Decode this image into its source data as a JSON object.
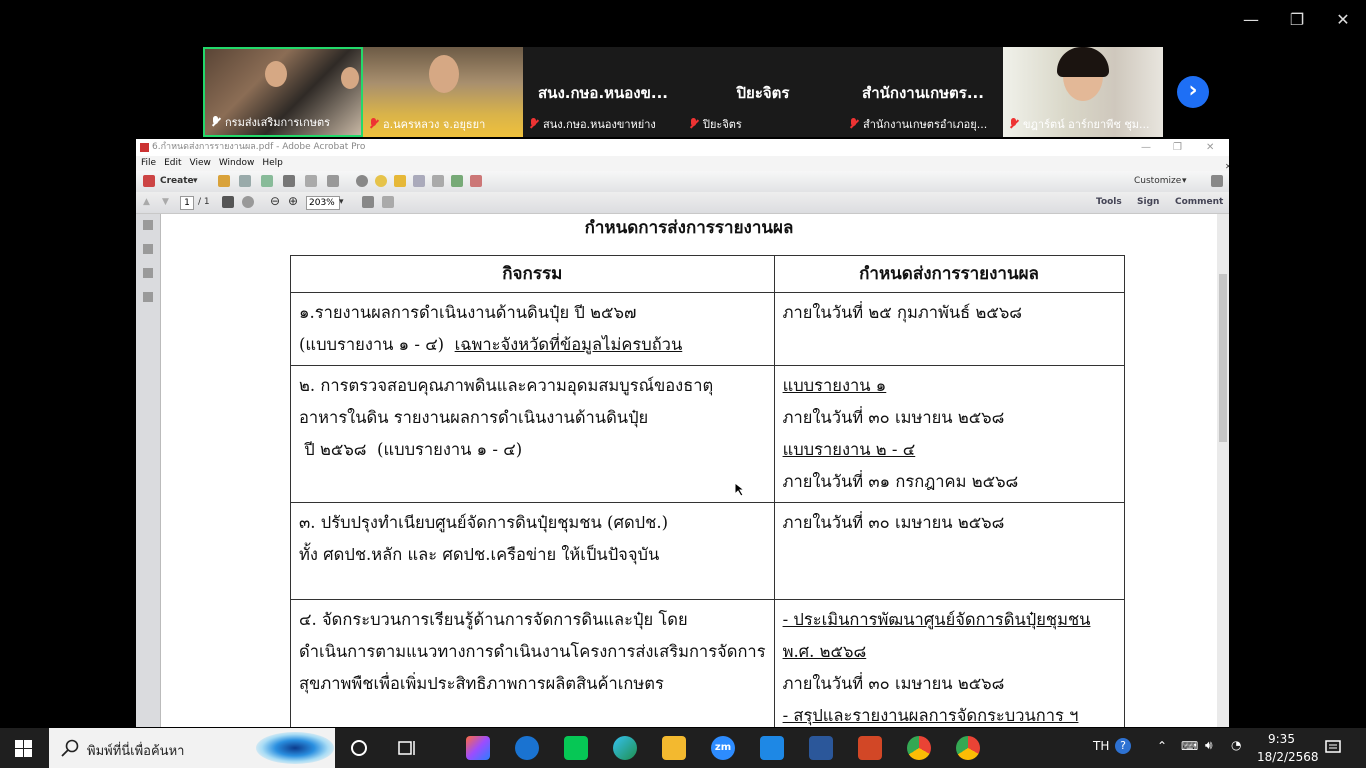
{
  "window_controls": {
    "minimize": "—",
    "restore": "❐",
    "close": "✕"
  },
  "zoom": {
    "participants": [
      {
        "label": "กรมส่งเสริมการเกษตร",
        "muted": false,
        "active": true
      },
      {
        "label": "อ.นครหลวง จ.อยุธยา",
        "muted": true
      },
      {
        "label": "สนง.กษอ.หนองขาหย่าง",
        "display": "สนง.กษอ.หนองข...",
        "muted": true
      },
      {
        "label": "ปิยะจิตร",
        "display": "ปิยะจิตร",
        "muted": true
      },
      {
        "label": "สำนักงานเกษตรอำเภอยุ...",
        "display": "สำนักงานเกษตร...",
        "muted": true
      },
      {
        "label": "ขฎาร์ตน์ อาร์กยาพีช ชุม...",
        "muted": true
      }
    ],
    "next_glyph": "›"
  },
  "acrobat": {
    "title": "6.กำหนดส่งการรายงานผล.pdf - Adobe Acrobat Pro",
    "menu": [
      "File",
      "Edit",
      "View",
      "Window",
      "Help"
    ],
    "create_label": "Create",
    "customize_label": "Customize",
    "page_current": "1",
    "page_total": "/ 1",
    "zoom_level": "203%",
    "tools_label": "Tools",
    "sign_label": "Sign",
    "comment_label": "Comment"
  },
  "document": {
    "title": "กำหนดการส่งการรายงานผล",
    "headers": [
      "กิจกรรม",
      "กำหนดส่งการรายงานผล"
    ],
    "rows": [
      {
        "activity": [
          "๑.รายงานผลการดำเนินงานด้านดินปุ๋ย ปี ๒๕๖๗"
        ],
        "activity_line2_plain": "(แบบรายงาน ๑ - ๔)  ",
        "activity_line2_underline": "เฉพาะจังหวัดที่ข้อมูลไม่ครบถ้วน",
        "deadline": [
          {
            "text": "ภายในวันที่ ๒๕ กุมภาพันธ์ ๒๕๖๘",
            "u": false
          }
        ]
      },
      {
        "activity": [
          "๒. การตรวจสอบคุณภาพดินและความอุดมสมบูรณ์ของธาตุ",
          "อาหารในดิน รายงานผลการดำเนินงานด้านดินปุ๋ย",
          " ปี ๒๕๖๘  (แบบรายงาน ๑ - ๔)"
        ],
        "deadline": [
          {
            "text": "แบบรายงาน ๑",
            "u": true
          },
          {
            "text": "ภายในวันที่ ๓๐ เมษายน ๒๕๖๘",
            "u": false
          },
          {
            "text": "แบบรายงาน ๒ - ๔",
            "u": true
          },
          {
            "text": "ภายในวันที่ ๓๑ กรกฎาคม ๒๕๖๘",
            "u": false
          }
        ]
      },
      {
        "activity": [
          "๓. ปรับปรุงทำเนียบศูนย์จัดการดินปุ๋ยชุมชน (ศดปช.)",
          "ทั้ง ศดปช.หลัก และ ศดปช.เครือข่าย ให้เป็นปัจจุบัน"
        ],
        "deadline": [
          {
            "text": "ภายในวันที่ ๓๐ เมษายน ๒๕๖๘",
            "u": false
          }
        ]
      },
      {
        "activity": [
          "๔. จัดกระบวนการเรียนรู้ด้านการจัดการดินและปุ๋ย โดย",
          "ดำเนินการตามแนวทางการดำเนินงานโครงการส่งเสริมการจัดการ",
          "สุขภาพพืชเพื่อเพิ่มประสิทธิภาพการผลิตสินค้าเกษตร"
        ],
        "deadline": [
          {
            "text": "- ประเมินการพัฒนาศูนย์จัดการดินปุ๋ยชุมชน",
            "u": true
          },
          {
            "text": "พ.ศ. ๒๕๖๘",
            "u": true
          },
          {
            "text": "ภายในวันที่ ๓๐ เมษายน ๒๕๖๘",
            "u": false
          },
          {
            "text": "- สรุปและรายงานผลการจัดกระบวนการ ฯ",
            "u": true
          }
        ]
      }
    ]
  },
  "taskbar": {
    "search_placeholder": "พิมพ์ที่นี่เพื่อค้นหา",
    "language": "TH",
    "time": "9:35",
    "date": "18/2/2568",
    "app_zoom_label": "zm"
  },
  "colors": {
    "zoom_active_border": "#23d96b",
    "zoom_next": "#1e6ff5",
    "taskbar": "#1f1f1f"
  }
}
